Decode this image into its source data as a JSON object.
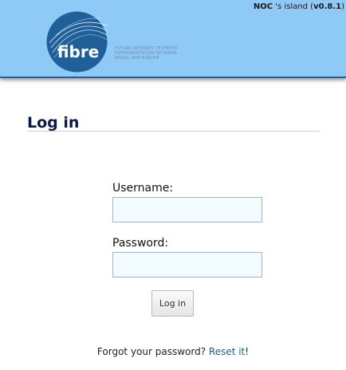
{
  "header": {
    "island_name": "NOC",
    "island_suffix": " 's island (",
    "version": "v0.8.1",
    "island_close": ")",
    "logo_text": "fibre",
    "tagline_lines": [
      "FUTURE INTERNET TESTBEDS",
      "EXPERIMENTATION BETWEEN",
      "BRAZIL AND EUROPE"
    ],
    "brand_color": "#8fcaf6",
    "logo_color": "#1f5f9a"
  },
  "page": {
    "title": "Log in"
  },
  "form": {
    "username_label": "Username:",
    "username_value": "",
    "password_label": "Password:",
    "password_value": "",
    "submit_label": "Log in"
  },
  "footer": {
    "forgot_text": "Forgot your password? ",
    "reset_link": "Reset it",
    "reset_suffix": "!"
  }
}
